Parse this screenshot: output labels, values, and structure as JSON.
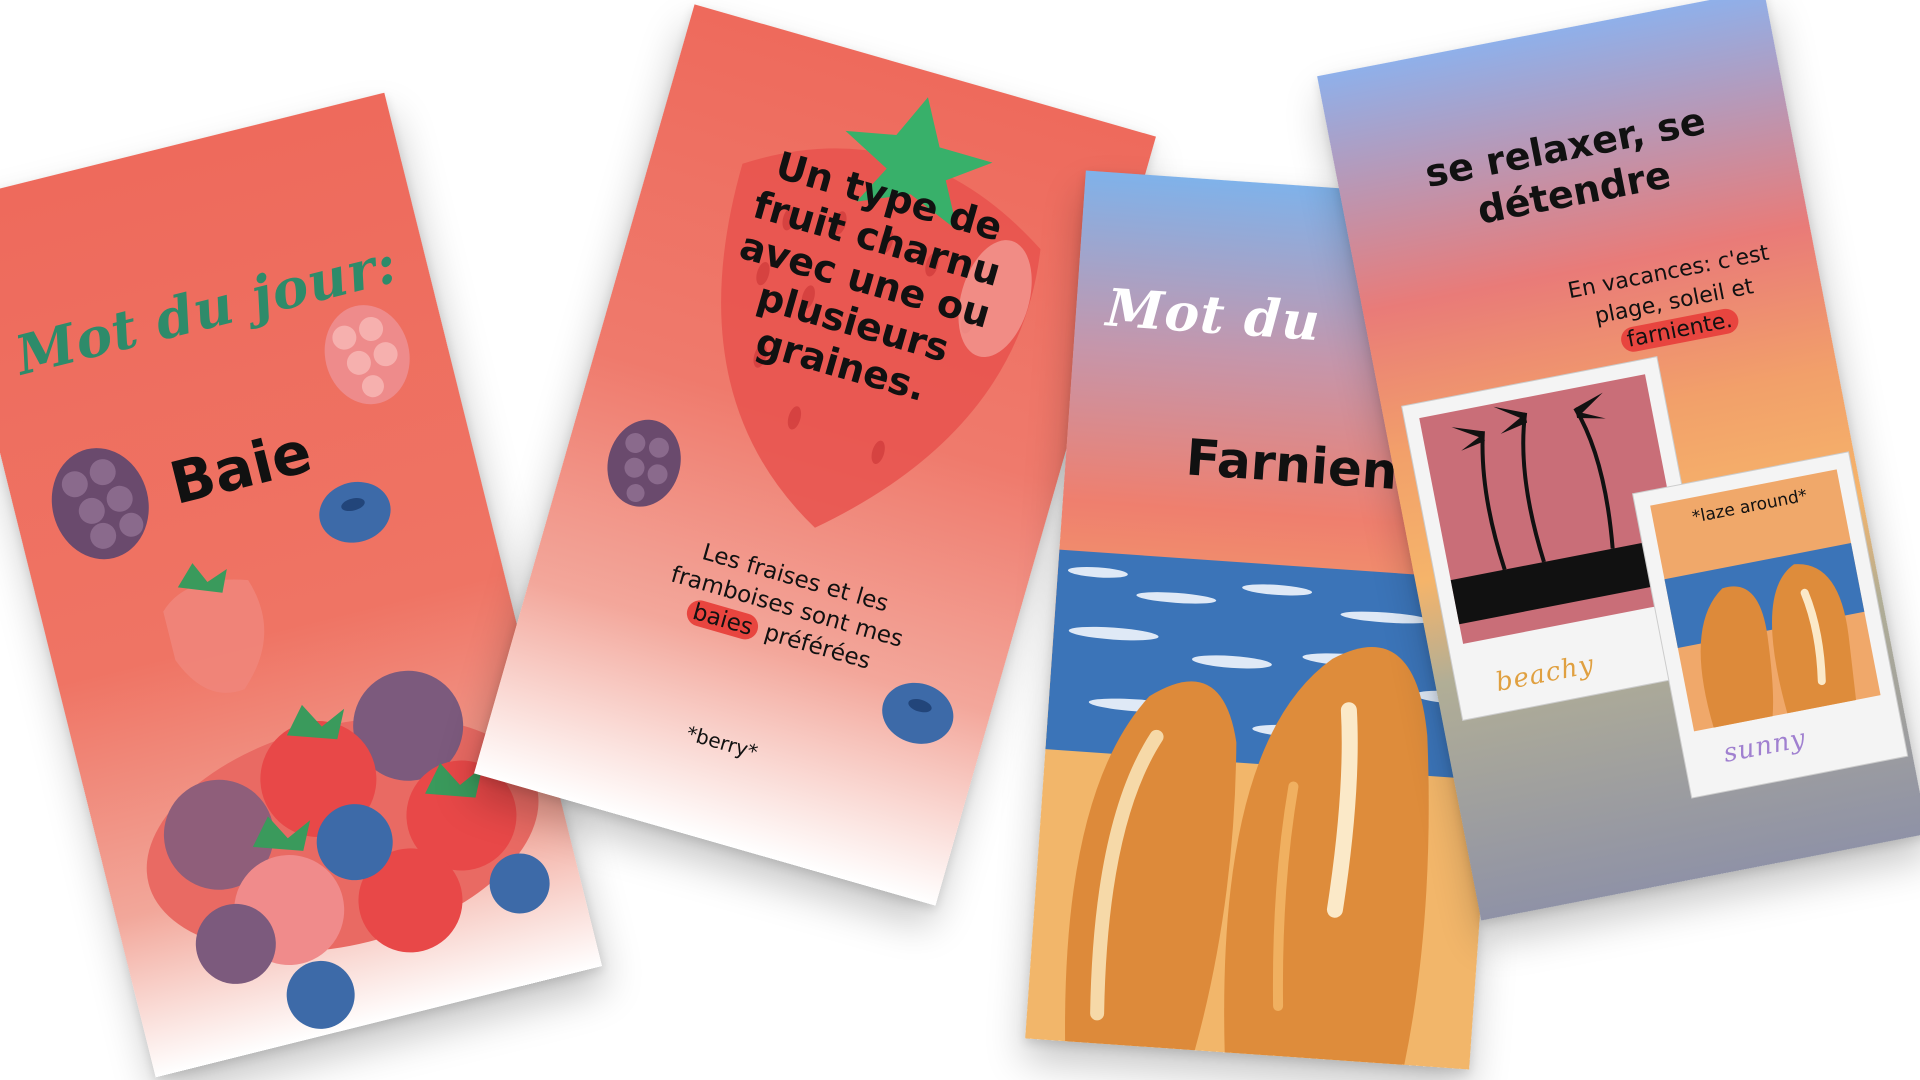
{
  "colors": {
    "berry_card_top": "#ee6a5c",
    "berry_card_bottom": "#ffffff",
    "highlight": "#e8453f",
    "title_green": "#2e8b6a",
    "sunset_sky_top": "#7fb2ea",
    "sunset_sky_mid": "#ef7f6e",
    "sunset_sky_low": "#f2b66a",
    "sea_blue": "#3b74b8",
    "churro_orange": "#dd8a3a"
  },
  "card_baie_front": {
    "title_script": "Mot du jour:",
    "word": "Baie",
    "icons": [
      "blackberry-icon",
      "raspberry-icon",
      "blueberry-icon",
      "strawberry-icon"
    ]
  },
  "card_baie_back": {
    "definition": "Un type de fruit charnu avec une ou plusieurs graines.",
    "example_before": "Les fraises et les framboises sont mes",
    "example_highlight": "baies",
    "example_after": "préférées",
    "translation": "*berry*"
  },
  "card_farniente_front": {
    "title_script": "Mot du",
    "word": "Farnien"
  },
  "card_farniente_back": {
    "definition": "se relaxer, se détendre",
    "example_before": "En vacances: c'est plage, soleil et",
    "example_highlight": "farniente.",
    "photo_caption_left": "beachy",
    "photo_caption_right": "sunny",
    "translation": "*laze around*"
  }
}
